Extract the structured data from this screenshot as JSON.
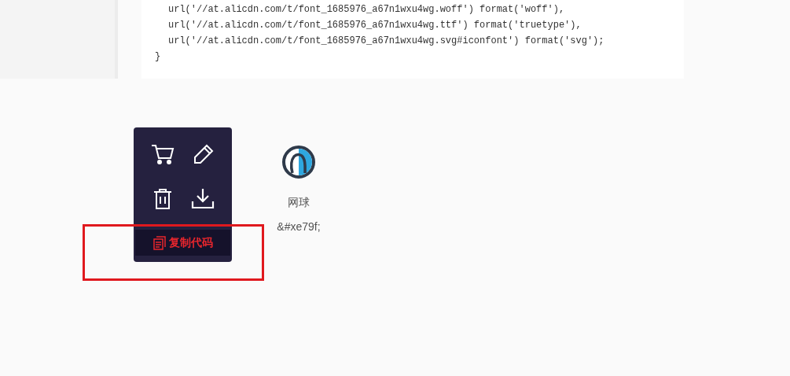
{
  "code_block": {
    "lines": [
      {
        "indent": true,
        "text": "url('//at.alicdn.com/t/font_1685976_a67n1wxu4wg.woff') format('woff'),"
      },
      {
        "indent": true,
        "text": "url('//at.alicdn.com/t/font_1685976_a67n1wxu4wg.ttf') format('truetype'),"
      },
      {
        "indent": true,
        "text": "url('//at.alicdn.com/t/font_1685976_a67n1wxu4wg.svg#iconfont') format('svg');"
      },
      {
        "indent": false,
        "text": "}"
      }
    ]
  },
  "hover_menu": {
    "copy_button": "复制代码"
  },
  "icon_cards": [
    {
      "name": "网球",
      "code": "&#xe79f;"
    }
  ]
}
